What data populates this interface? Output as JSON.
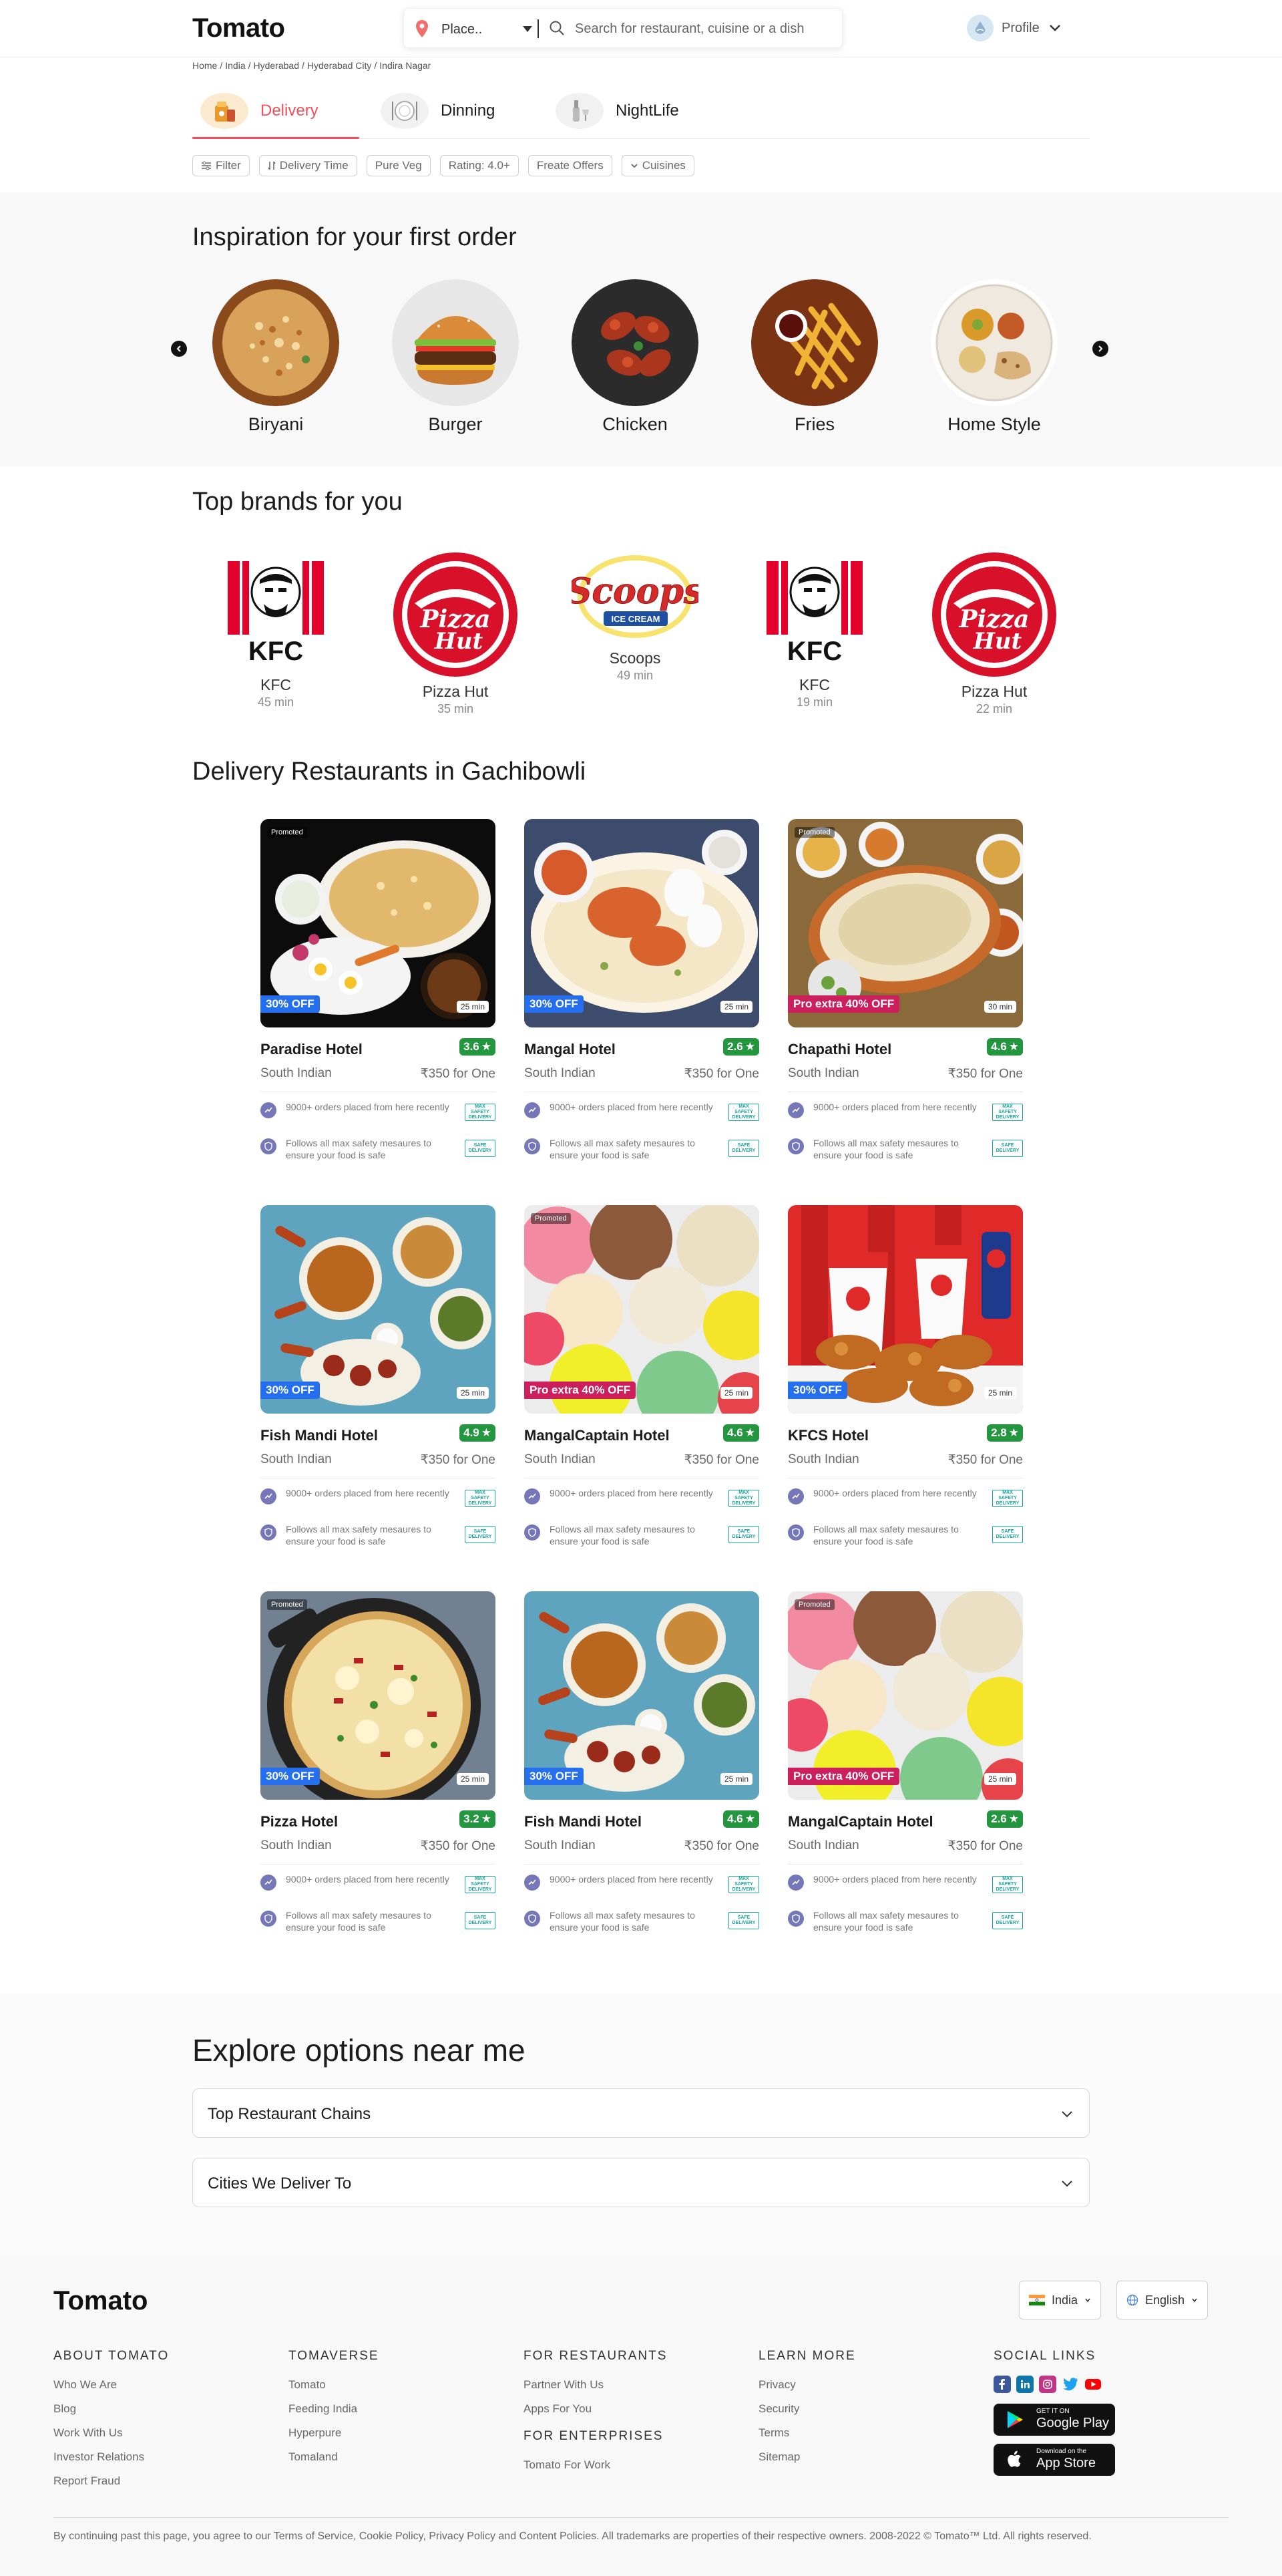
{
  "header": {
    "logo": "Tomato",
    "location_placeholder": "Place..",
    "search_placeholder": "Search for restaurant, cuisine or a dish",
    "profile_label": "Profile"
  },
  "breadcrumb": [
    "Home",
    "India",
    "Hyderabad",
    "Hyderabad City",
    "Indira Nagar"
  ],
  "tabs": [
    {
      "label": "Delivery",
      "active": true
    },
    {
      "label": "Dinning",
      "active": false
    },
    {
      "label": "NightLife",
      "active": false
    }
  ],
  "filters": [
    "Filter",
    "Delivery Time",
    "Pure Veg",
    "Rating: 4.0+",
    "Freate Offers",
    "Cuisines"
  ],
  "inspiration": {
    "title": "Inspiration for your first order",
    "items": [
      "Biryani",
      "Burger",
      "Chicken",
      "Fries",
      "Home Style"
    ]
  },
  "brands": {
    "title": "Top brands for you",
    "items": [
      {
        "name": "KFC",
        "time": "45 min"
      },
      {
        "name": "Pizza Hut",
        "time": "35 min"
      },
      {
        "name": "Scoops",
        "time": "49 min"
      },
      {
        "name": "KFC",
        "time": "19 min"
      },
      {
        "name": "Pizza Hut",
        "time": "22 min"
      }
    ]
  },
  "restaurants": {
    "title": "Delivery Restaurants in Gachibowli",
    "promoted_label": "Promoted",
    "info1": "9000+ orders placed from here recently",
    "info2": "Follows all max safety mesaures to ensure your food is safe",
    "badge1": "MAX SAFETY DELIVERY",
    "badge2": "SAFE DELIVERY",
    "items": [
      {
        "name": "Paradise Hotel",
        "rating": "3.6",
        "cuisine": "South Indian",
        "price": "₹350 for One",
        "offer": "30% OFF",
        "offer_type": "blue",
        "eta": "25 min",
        "promoted": true
      },
      {
        "name": "Mangal Hotel",
        "rating": "2.6",
        "cuisine": "South Indian",
        "price": "₹350 for One",
        "offer": "30% OFF",
        "offer_type": "blue",
        "eta": "25 min",
        "promoted": false
      },
      {
        "name": "Chapathi Hotel",
        "rating": "4.6",
        "cuisine": "South Indian",
        "price": "₹350 for One",
        "offer": "Pro extra 40% OFF",
        "offer_type": "pink",
        "eta": "30 min",
        "promoted": true
      },
      {
        "name": "Fish Mandi Hotel",
        "rating": "4.9",
        "cuisine": "South Indian",
        "price": "₹350 for One",
        "offer": "30% OFF",
        "offer_type": "blue",
        "eta": "25 min",
        "promoted": false
      },
      {
        "name": "MangalCaptain Hotel",
        "rating": "4.6",
        "cuisine": "South Indian",
        "price": "₹350 for One",
        "offer": "Pro extra 40% OFF",
        "offer_type": "pink",
        "eta": "25 min",
        "promoted": true
      },
      {
        "name": "KFCS Hotel",
        "rating": "2.8",
        "cuisine": "South Indian",
        "price": "₹350 for One",
        "offer": "30% OFF",
        "offer_type": "blue",
        "eta": "25 min",
        "promoted": false
      },
      {
        "name": "Pizza Hotel",
        "rating": "3.2",
        "cuisine": "South Indian",
        "price": "₹350 for One",
        "offer": "30% OFF",
        "offer_type": "blue",
        "eta": "25 min",
        "promoted": true
      },
      {
        "name": "Fish Mandi Hotel",
        "rating": "4.6",
        "cuisine": "South Indian",
        "price": "₹350 for One",
        "offer": "30% OFF",
        "offer_type": "blue",
        "eta": "25 min",
        "promoted": false
      },
      {
        "name": "MangalCaptain Hotel",
        "rating": "2.6",
        "cuisine": "South Indian",
        "price": "₹350 for One",
        "offer": "Pro extra 40% OFF",
        "offer_type": "pink",
        "eta": "25 min",
        "promoted": true
      }
    ]
  },
  "explore": {
    "title": "Explore options near me",
    "items": [
      "Top Restaurant Chains",
      "Cities We Deliver To"
    ]
  },
  "footer": {
    "logo": "Tomato",
    "country": "India",
    "language": "English",
    "columns": [
      {
        "heading": "ABOUT TOMATO",
        "links": [
          "Who We Are",
          "Blog",
          "Work With Us",
          "Investor Relations",
          "Report Fraud"
        ]
      },
      {
        "heading": "TOMAVERSE",
        "links": [
          "Tomato",
          "Feeding India",
          "Hyperpure",
          "Tomaland"
        ]
      },
      {
        "heading": "FOR RESTAURANTS",
        "links": [
          "Partner With Us",
          "Apps For You"
        ]
      },
      {
        "heading": "FOR ENTERPRISES",
        "links": [
          "Tomato For Work"
        ]
      },
      {
        "heading": "LEARN MORE",
        "links": [
          "Privacy",
          "Security",
          "Terms",
          "Sitemap"
        ]
      },
      {
        "heading": "SOCIAL LINKS",
        "links": []
      }
    ],
    "google_play_small": "GET IT ON",
    "google_play_big": "Google Play",
    "app_store_small": "Download on the",
    "app_store_big": "App Store",
    "legal": "By continuing past this page, you agree to our Terms of Service, Cookie Policy, Privacy Policy and Content Policies. All trademarks are properties of their respective owners. 2008-2022 © Tomato™ Ltd. All rights reserved."
  },
  "colors": {
    "accent": "#ef4f5f",
    "rating_green": "#24963f",
    "offer_blue": "#256fef",
    "offer_pink": "#cd1f5c"
  }
}
